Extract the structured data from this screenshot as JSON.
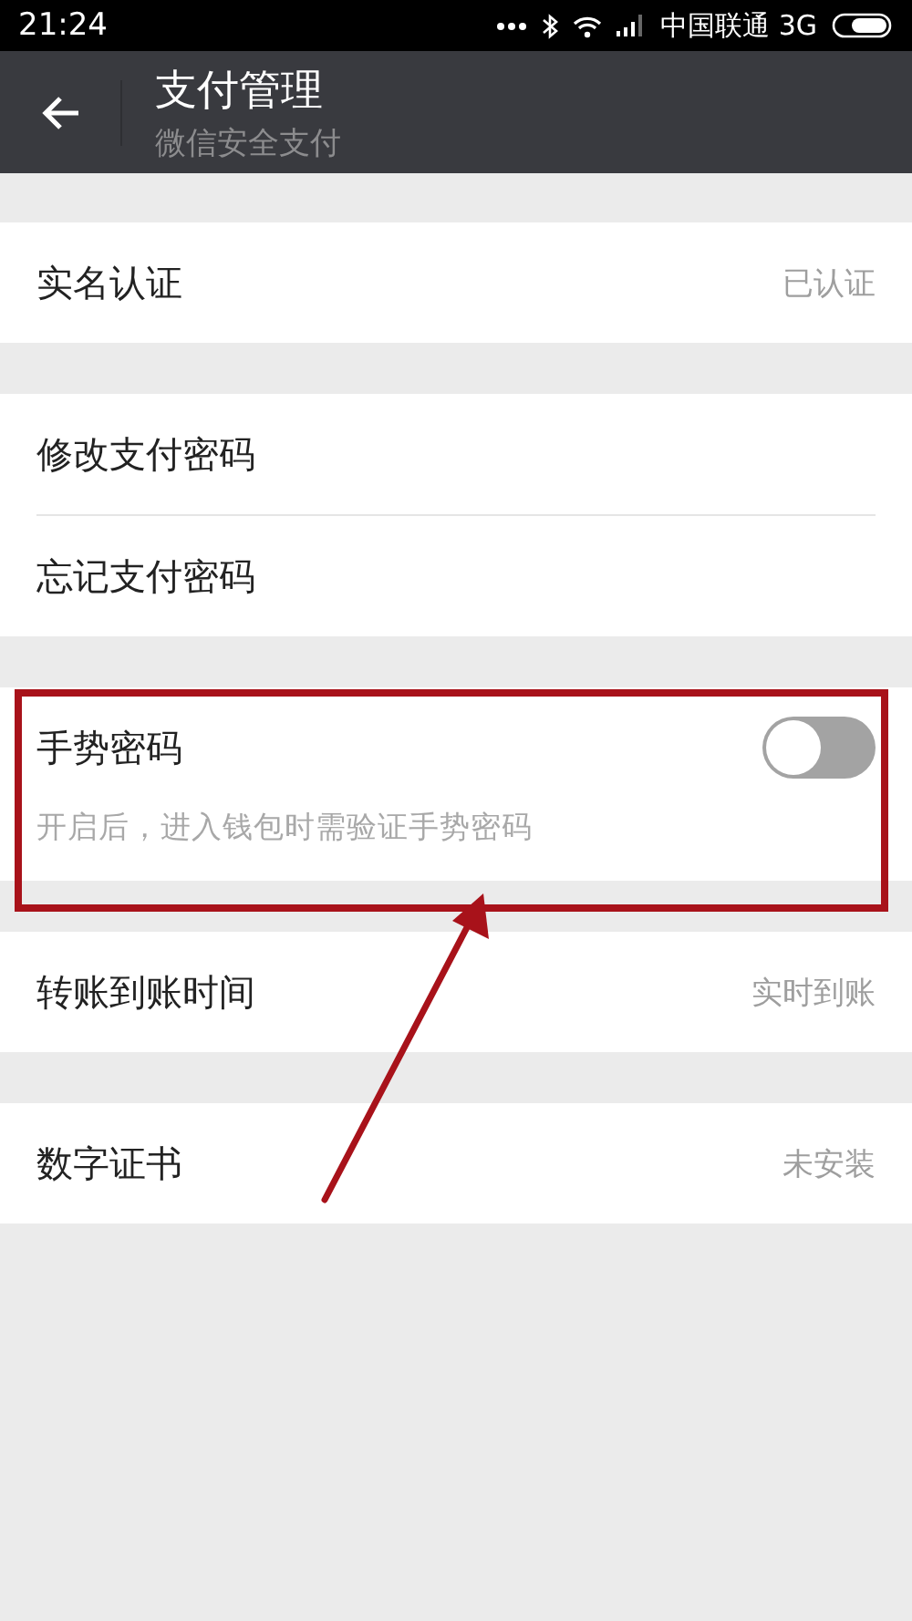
{
  "status_bar": {
    "time": "21:24",
    "carrier": "中国联通 3G"
  },
  "header": {
    "title": "支付管理",
    "subtitle": "微信安全支付"
  },
  "groups": [
    {
      "highlight": false,
      "items": [
        {
          "kind": "row",
          "label": "实名认证",
          "value": "已认证"
        }
      ]
    },
    {
      "highlight": false,
      "items": [
        {
          "kind": "row",
          "label": "修改支付密码"
        },
        {
          "kind": "row",
          "label": "忘记支付密码"
        }
      ]
    },
    {
      "highlight": true,
      "items": [
        {
          "kind": "toggle",
          "label": "手势密码",
          "on": false,
          "hint": "开启后，进入钱包时需验证手势密码"
        }
      ]
    },
    {
      "highlight": false,
      "items": [
        {
          "kind": "row",
          "label": "转账到账时间",
          "value": "实时到账"
        }
      ]
    },
    {
      "highlight": false,
      "items": [
        {
          "kind": "row",
          "label": "数字证书",
          "value": "未安装"
        }
      ]
    }
  ]
}
